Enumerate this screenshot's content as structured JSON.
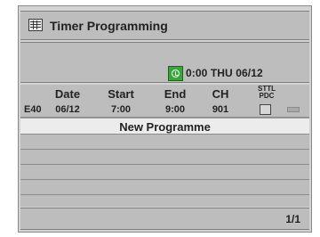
{
  "title": "Timer Programming",
  "clock": {
    "text": "0:00 THU 06/12"
  },
  "columns": {
    "date": "Date",
    "start": "Start",
    "end": "End",
    "ch": "CH",
    "sttl": "STTL",
    "pdc": "PDC"
  },
  "programmes": [
    {
      "num": "E40",
      "date": "06/12",
      "start": "7:00",
      "end": "9:00",
      "ch": "901",
      "sttl_pdc_checked": false
    }
  ],
  "new_programme_label": "New Programme",
  "page_indicator": "1/1"
}
